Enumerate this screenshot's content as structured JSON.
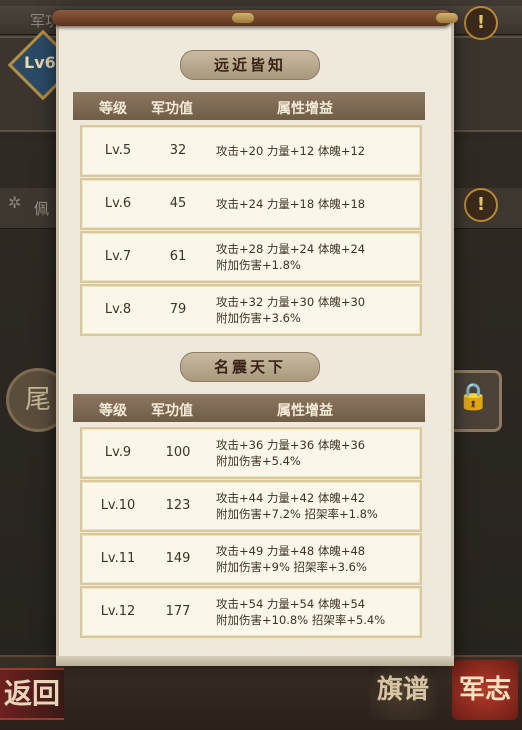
{
  "background": {
    "top_bar_label": "军功等级",
    "level_badge": "Lv6",
    "row_label": "佩",
    "left_seal_char": "尾",
    "back_button": "返回",
    "seal_qipu": "旗谱",
    "seal_junzhi": "军志",
    "alert_symbol": "!",
    "lock_symbol": "🔒"
  },
  "scroll": {
    "header": {
      "level": "等级",
      "merit": "军功值",
      "attr": "属性增益"
    },
    "sections": [
      {
        "title": "远近皆知",
        "rows": [
          {
            "level": "Lv.5",
            "merit": "32",
            "line1": "攻击+20   力量+12   体魄+12",
            "line2": ""
          },
          {
            "level": "Lv.6",
            "merit": "45",
            "line1": "攻击+24   力量+18   体魄+18",
            "line2": ""
          },
          {
            "level": "Lv.7",
            "merit": "61",
            "line1": "攻击+28   力量+24   体魄+24",
            "line2": "附加伤害+1.8%"
          },
          {
            "level": "Lv.8",
            "merit": "79",
            "line1": "攻击+32   力量+30   体魄+30",
            "line2": "附加伤害+3.6%"
          }
        ]
      },
      {
        "title": "名震天下",
        "rows": [
          {
            "level": "Lv.9",
            "merit": "100",
            "line1": "攻击+36   力量+36   体魄+36",
            "line2": "附加伤害+5.4%"
          },
          {
            "level": "Lv.10",
            "merit": "123",
            "line1": "攻击+44   力量+42   体魄+42",
            "line2": "附加伤害+7.2%   招架率+1.8%"
          },
          {
            "level": "Lv.11",
            "merit": "149",
            "line1": "攻击+49   力量+48   体魄+48",
            "line2": "附加伤害+9%     招架率+3.6%"
          },
          {
            "level": "Lv.12",
            "merit": "177",
            "line1": "攻击+54   力量+54   体魄+54",
            "line2": "附加伤害+10.8%   招架率+5.4%"
          }
        ]
      }
    ]
  }
}
